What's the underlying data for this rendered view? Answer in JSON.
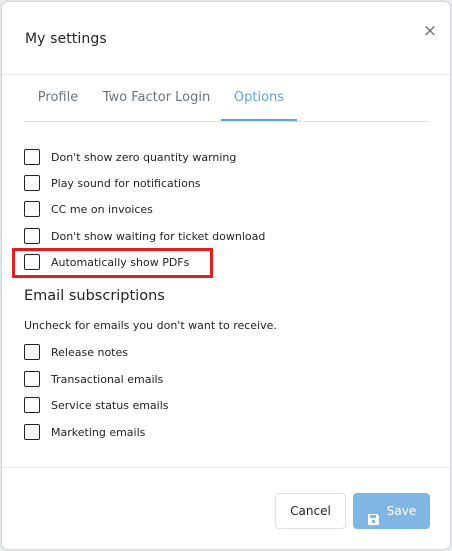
{
  "modal": {
    "title": "My settings",
    "close_icon": "close-icon",
    "close_glyph": "×"
  },
  "tabs": [
    {
      "label": "Profile",
      "active": false
    },
    {
      "label": "Two Factor Login",
      "active": false
    },
    {
      "label": "Options",
      "active": true
    }
  ],
  "options": [
    {
      "label": "Don't show zero quantity warning",
      "checked": false
    },
    {
      "label": "Play sound for notifications",
      "checked": false
    },
    {
      "label": "CC me on invoices",
      "checked": false
    },
    {
      "label": "Don't show waiting for ticket download",
      "checked": false
    },
    {
      "label": "Automatically show PDFs",
      "checked": false,
      "highlighted": true
    }
  ],
  "email_subscriptions": {
    "title": "Email subscriptions",
    "subtitle": "Uncheck for emails you don't want to receive.",
    "items": [
      {
        "label": "Release notes",
        "checked": false
      },
      {
        "label": "Transactional emails",
        "checked": false
      },
      {
        "label": "Service status emails",
        "checked": false
      },
      {
        "label": "Marketing emails",
        "checked": false
      }
    ]
  },
  "footer": {
    "cancel_label": "Cancel",
    "save_label": "Save",
    "save_icon": "floppy-disk-icon"
  },
  "colors": {
    "accent": "#5aa5dc",
    "save_button": "#7fb6e3",
    "highlight": "#e01e1e"
  }
}
